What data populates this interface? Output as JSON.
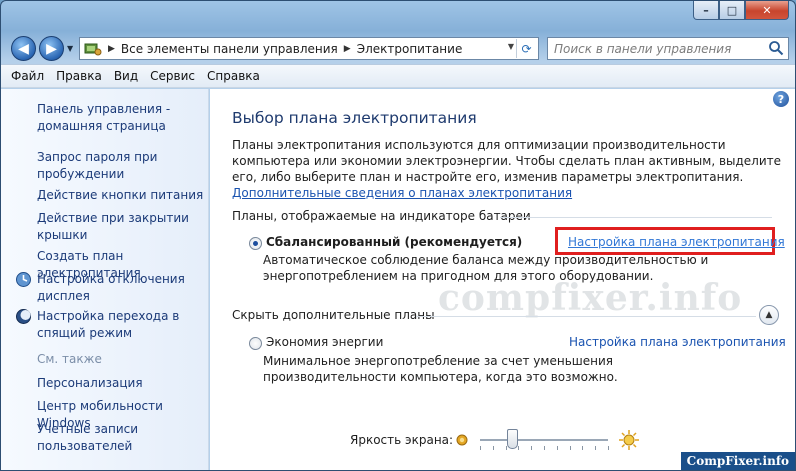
{
  "window": {
    "caption_buttons": {
      "minimize": "–",
      "maximize": "□",
      "close": "✕"
    }
  },
  "address_bar": {
    "breadcrumbs": [
      "Все элементы панели управления",
      "Электропитание"
    ],
    "search_placeholder": "Поиск в панели управления"
  },
  "menu": [
    "Файл",
    "Правка",
    "Вид",
    "Сервис",
    "Справка"
  ],
  "sidebar": {
    "links": [
      "Панель управления - домашняя страница",
      "Запрос пароля при пробуждении",
      "Действие кнопки питания",
      "Действие при закрытии крышки",
      "Создать план электропитания",
      "Настройка отключения дисплея",
      "Настройка перехода в спящий режим"
    ],
    "see_also_heading": "См. также",
    "see_also": [
      "Персонализация",
      "Центр мобильности Windows",
      "Учетные записи пользователей"
    ]
  },
  "main": {
    "title": "Выбор плана электропитания",
    "intro": "Планы электропитания используются для оптимизации производительности компьютера или экономии электроэнергии. Чтобы сделать план активным, выделите его, либо выберите план и настройте его, изменив параметры электропитания.",
    "intro_link": "Дополнительные сведения о планах электропитания",
    "battery_section_title": "Планы, отображаемые на индикаторе батареи",
    "balanced": {
      "name": "Сбалансированный (рекомендуется)",
      "description": "Автоматическое соблюдение баланса между производительностью и энергопотреблением на пригодном для этого оборудовании.",
      "link": "Настройка плана электропитания",
      "selected": true
    },
    "hide_section_title": "Скрыть дополнительные планы",
    "economy": {
      "name": "Экономия энергии",
      "description": "Минимальное энергопотребление за счет уменьшения производительности компьютера, когда это возможно.",
      "link": "Настройка плана электропитания",
      "selected": false
    },
    "brightness_label": "Яркость экрана:",
    "brightness_level": 0.25
  },
  "watermark": "compfixer.info",
  "footer_badge": "CompFixer.info",
  "colors": {
    "link": "#1a53b0",
    "highlight": "#e01f1f",
    "sidebar_link": "#1b3a78"
  }
}
